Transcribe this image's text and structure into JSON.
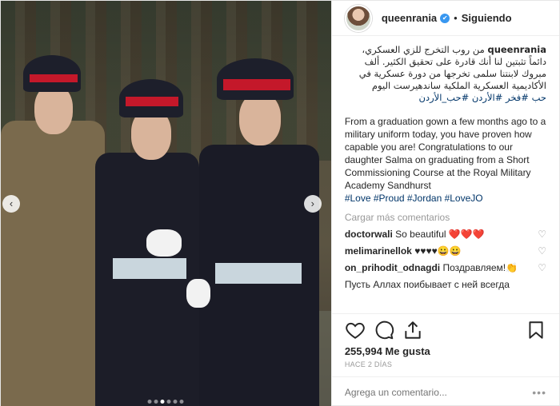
{
  "post": {
    "username": "queenrania",
    "follow_label": "Siguiendo",
    "separator": "•",
    "caption_arabic": "من روب التخرج للزي العسكري، دائماً تثبتين لنا أنك قادرة على تحقيق الكثير. ألف مبروك لابنتنا سلمى تخرجها من دورة عسكرية في الأكاديمية العسكرية الملكية ساندهيرست اليوم",
    "caption_arabic_tags": "حب  #فخر #الأردن #حب_الأردن",
    "caption_english": "From a graduation gown a few months ago to a military uniform today, you have proven how capable you are! Congratulations to our daughter Salma on graduating from a Short Commissioning Course at the Royal Military Academy Sandhurst",
    "caption_english_tags": "#Love #Proud #Jordan #LoveJO",
    "load_more": "Cargar más comentarios",
    "comments": [
      {
        "user": "doctorwali",
        "text": "So beautiful ❤️❤️❤️"
      },
      {
        "user": "melimarinellok",
        "text": "♥♥♥♥😀😀"
      },
      {
        "user": "on_prihodit_odnagdi",
        "text": "Поздравляем!👏"
      },
      {
        "user": "",
        "text": "Пусть Аллах поибывает с ней всегда"
      }
    ],
    "likes": "255,994 Me gusta",
    "time": "HACE 2 DÍAS",
    "comment_placeholder": "Agrega un comentario...",
    "more_label": "•••"
  },
  "media": {
    "prev_label": "‹",
    "next_label": "›",
    "carousel_count": 6,
    "carousel_active": 2
  },
  "icons": {
    "heart": "heart-icon",
    "comment": "comment-icon",
    "share": "share-icon",
    "bookmark": "bookmark-icon",
    "verified": "verified-icon"
  },
  "colors": {
    "link": "#003569",
    "verified": "#3897f0",
    "muted": "#999999"
  }
}
